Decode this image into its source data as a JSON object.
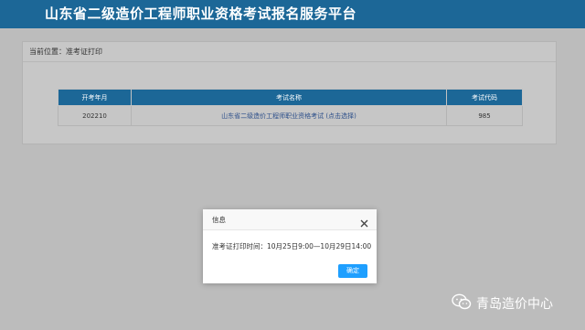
{
  "header": {
    "title": "山东省二级造价工程师职业资格考试报名服务平台"
  },
  "breadcrumb": "当前位置：准考证打印",
  "table": {
    "columns": [
      "开考年月",
      "考试名称",
      "考试代码"
    ],
    "rows": [
      {
        "date": "202210",
        "name": "山东省二级造价工程师职业资格考试 (点击选择)",
        "code": "985"
      }
    ]
  },
  "dialog": {
    "title": "信息",
    "message": "准考证打印时间：10月25日9:00—10月29日14:00",
    "ok_label": "确定"
  },
  "watermark": {
    "text": "青岛造价中心"
  },
  "colors": {
    "header": "#1c6797",
    "ok_button": "#1e9fff"
  }
}
